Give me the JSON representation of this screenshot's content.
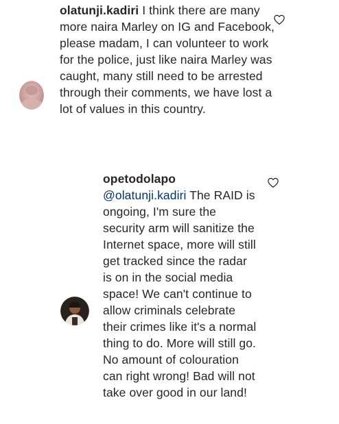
{
  "comments": [
    {
      "username": "olatunji.kadiri",
      "text": "I think there are many more naira Marley on IG and Facebook, please madam, I can volunteer to work for the police, just like naira Marley was caught, many still need to be arrested through their comments, we have lost a lot of values in this country.",
      "avatar_icon": "user-avatar",
      "like_icon": "heart-outline-icon"
    }
  ],
  "replies": [
    {
      "username": "opetodolapo",
      "mention": "@olatunji.kadiri",
      "text": "The RAID is ongoing, I'm sure the security arm will sanitize the Internet space, more will still get tracked since the radar is on in the social media space! We can't continue to allow criminals celebrate their crimes like it's a normal thing to do. More will still go. No amount of colouration can right wrong! Bad will not take over good in our land!",
      "avatar_icon": "user-avatar",
      "like_icon": "heart-outline-icon"
    }
  ]
}
